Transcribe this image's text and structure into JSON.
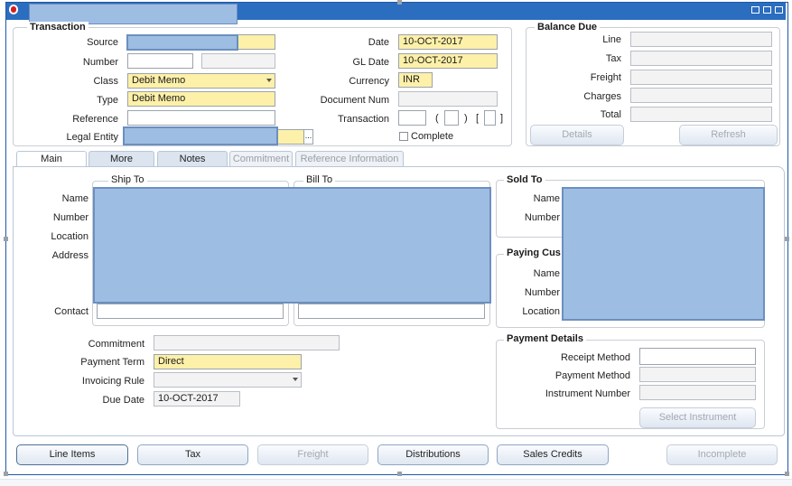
{
  "window": {
    "title": ""
  },
  "transaction": {
    "group_title": "Transaction",
    "source_label": "Source",
    "number_label": "Number",
    "class_label": "Class",
    "class_value": "Debit Memo",
    "type_label": "Type",
    "type_value": "Debit Memo",
    "reference_label": "Reference",
    "legal_entity_label": "Legal Entity",
    "date_label": "Date",
    "date_value": "10-OCT-2017",
    "gl_date_label": "GL Date",
    "gl_date_value": "10-OCT-2017",
    "currency_label": "Currency",
    "currency_value": "INR",
    "document_num_label": "Document Num",
    "transaction_label": "Transaction",
    "paren_open": "(",
    "paren_close": ")",
    "bracket_open": "[",
    "bracket_close": "]",
    "complete_label": "Complete",
    "ellipsis": "..."
  },
  "balance_due": {
    "title": "Balance Due",
    "line_label": "Line",
    "tax_label": "Tax",
    "freight_label": "Freight",
    "charges_label": "Charges",
    "total_label": "Total",
    "details_button": "Details",
    "refresh_button": "Refresh"
  },
  "tabs": [
    {
      "label": "Main"
    },
    {
      "label": "More"
    },
    {
      "label": "Notes"
    },
    {
      "label": "Commitment"
    },
    {
      "label": "Reference Information"
    }
  ],
  "main": {
    "ship_to_title": "Ship To",
    "bill_to_title": "Bill To",
    "name_label": "Name",
    "number_label": "Number",
    "location_label": "Location",
    "address_label": "Address",
    "contact_label": "Contact",
    "sold_to_title": "Sold To",
    "sold_name_label": "Name",
    "sold_number_label": "Number",
    "paying_title": "Paying Cus",
    "paying_name_label": "Name",
    "paying_number_label": "Number",
    "paying_location_label": "Location",
    "commitment_label": "Commitment",
    "payment_term_label": "Payment Term",
    "payment_term_value": "Direct",
    "invoicing_rule_label": "Invoicing Rule",
    "due_date_label": "Due Date",
    "due_date_value": "10-OCT-2017",
    "payment_details_title": "Payment Details",
    "receipt_method_label": "Receipt Method",
    "payment_method_label": "Payment Method",
    "instrument_number_label": "Instrument Number",
    "select_instrument_button": "Select Instrument"
  },
  "buttons": {
    "line_items": "Line Items",
    "tax": "Tax",
    "freight": "Freight",
    "distributions": "Distributions",
    "sales_credits": "Sales Credits",
    "incomplete": "Incomplete"
  },
  "colors": {
    "title_bar": "#2b6dbf",
    "required_field": "#fdf0a8",
    "redaction": "#9ebde2"
  }
}
